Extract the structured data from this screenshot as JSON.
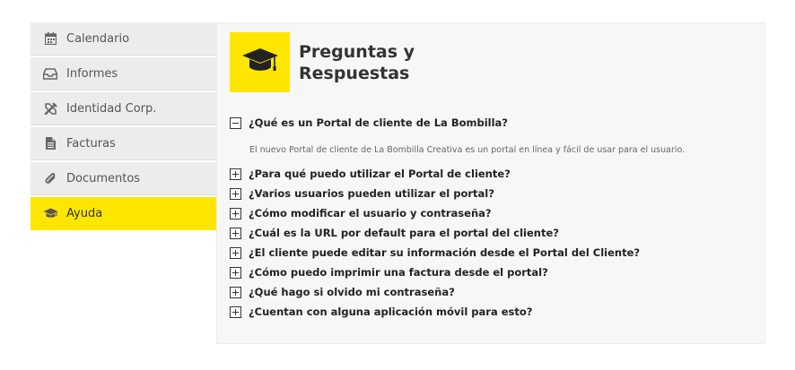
{
  "sidebar": {
    "items": [
      {
        "label": "Calendario",
        "icon": "calendar-icon"
      },
      {
        "label": "Informes",
        "icon": "inbox-icon"
      },
      {
        "label": "Identidad Corp.",
        "icon": "design-tools-icon"
      },
      {
        "label": "Facturas",
        "icon": "file-text-icon"
      },
      {
        "label": "Documentos",
        "icon": "paperclip-icon"
      },
      {
        "label": "Ayuda",
        "icon": "graduation-cap-icon",
        "active": true
      }
    ]
  },
  "header": {
    "title": "Preguntas y Respuestas",
    "icon": "graduation-cap-icon",
    "accent_color": "#ffe600"
  },
  "faq": {
    "expanded": {
      "question": "¿Qué es un Portal de cliente de La Bombilla?",
      "answer": "El nuevo Portal de cliente de La Bombilla Creativa es un portal en línea y fácil de usar para el usuario."
    },
    "questions": [
      "¿Para qué puedo utilizar el Portal de cliente?",
      "¿Varios usuarios pueden utilizar el portal?",
      "¿Cómo modificar el usuario y contraseña?",
      "¿Cuál es la URL por default para el portal del cliente?",
      "¿El cliente puede editar su información desde el Portal del Cliente?",
      "¿Cómo puedo imprimir una factura desde el portal?",
      "¿Qué hago si olvido mi contraseña?",
      "¿Cuentan con alguna aplicación móvil para esto?"
    ]
  }
}
